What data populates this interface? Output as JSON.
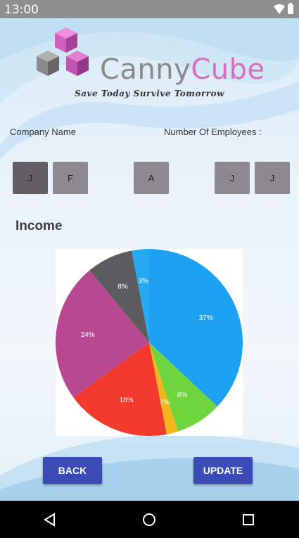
{
  "status_bar": {
    "time": "13:00"
  },
  "brand": {
    "name_part1": "Canny",
    "name_part2": "Cube",
    "tagline": "Save Today Survive Tomorrow"
  },
  "labels": {
    "company_name": "Company Name",
    "employees": "Number Of Employees :"
  },
  "letter_boxes": [
    "J",
    "F",
    "A",
    "J",
    "J"
  ],
  "income": {
    "title": "Income"
  },
  "chart_data": {
    "type": "pie",
    "slices": [
      {
        "value": 37,
        "label": "37%",
        "color": "#1da1f2"
      },
      {
        "value": 8,
        "label": "8%",
        "color": "#6ed63c"
      },
      {
        "value": 2,
        "label": "2%",
        "color": "#f2b51b"
      },
      {
        "value": 18,
        "label": "18%",
        "color": "#f23a2c"
      },
      {
        "value": 24,
        "label": "24%",
        "color": "#b8488f"
      },
      {
        "value": 8,
        "label": "8%",
        "color": "#5c5c5e"
      },
      {
        "value": 3,
        "label": "3%",
        "color": "#26a9f0"
      }
    ]
  },
  "buttons": {
    "back": "BACK",
    "update": "UPDATE"
  },
  "colors": {
    "button": "#3a4bb5",
    "brand_gray": "#8a8a8a",
    "brand_pink": "#d86fbe"
  }
}
